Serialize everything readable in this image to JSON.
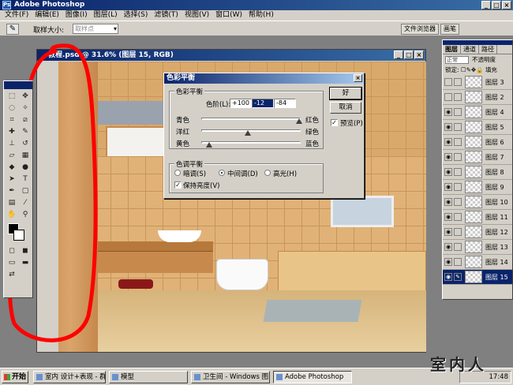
{
  "app": {
    "title": "Adobe Photoshop",
    "icon": "photoshop-icon"
  },
  "menu": [
    "文件(F)",
    "编辑(E)",
    "图像(I)",
    "图层(L)",
    "选择(S)",
    "滤镜(T)",
    "视图(V)",
    "窗口(W)",
    "帮助(H)"
  ],
  "options": {
    "sample_size_label": "取样大小:",
    "sample_size_value": "取样点"
  },
  "palette_well": [
    "文件浏览器",
    "画笔"
  ],
  "document": {
    "title": "教程.psd @ 31.6% (图层 15, RGB)"
  },
  "dialog": {
    "title": "色彩平衡",
    "balance_group": "色彩平衡",
    "levels_label": "色阶(L):",
    "levels": [
      "+100",
      "-12",
      "-84"
    ],
    "sliders": [
      {
        "left": "青色",
        "right": "红色",
        "value": 100
      },
      {
        "left": "洋红",
        "right": "绿色",
        "value": -12
      },
      {
        "left": "黄色",
        "right": "蓝色",
        "value": -84
      }
    ],
    "tone_group": "色调平衡",
    "tones": {
      "shadows": "暗调(S)",
      "midtones": "中间调(D)",
      "highlights": "高光(H)",
      "selected": "midtones"
    },
    "preserve_luminosity": "保持亮度(V)",
    "ok": "好",
    "cancel": "取消",
    "preview": "预览(P)"
  },
  "layers_panel": {
    "tabs": [
      "图层",
      "通道",
      "路径"
    ],
    "blend_mode": "正常",
    "opacity_label": "不透明度",
    "lock_label": "锁定:",
    "fill_label": "填充",
    "layers": [
      {
        "name": "图层 3",
        "visible": false,
        "selected": false
      },
      {
        "name": "图层 2",
        "visible": false,
        "selected": false
      },
      {
        "name": "图层 4",
        "visible": true,
        "selected": false
      },
      {
        "name": "图层 5",
        "visible": true,
        "selected": false
      },
      {
        "name": "图层 6",
        "visible": true,
        "selected": false
      },
      {
        "name": "图层 7",
        "visible": true,
        "selected": false
      },
      {
        "name": "图层 8",
        "visible": true,
        "selected": false
      },
      {
        "name": "图层 9",
        "visible": true,
        "selected": false
      },
      {
        "name": "图层 10",
        "visible": true,
        "selected": false
      },
      {
        "name": "图层 11",
        "visible": true,
        "selected": false
      },
      {
        "name": "图层 12",
        "visible": true,
        "selected": false
      },
      {
        "name": "图层 13",
        "visible": true,
        "selected": false
      },
      {
        "name": "图层 14",
        "visible": true,
        "selected": false
      },
      {
        "name": "图层 15",
        "visible": true,
        "selected": true
      }
    ]
  },
  "taskbar": {
    "start": "开始",
    "buttons": [
      "室内 设计+表现 - 群",
      "模型",
      "卫生间 - Windows 图...",
      "Adobe Photoshop"
    ],
    "clock": "17:48"
  },
  "watermark": "室内人",
  "colors": {
    "titlebar": "#0a246a",
    "annotation": "#ff0000",
    "face": "#d4d0c8"
  }
}
